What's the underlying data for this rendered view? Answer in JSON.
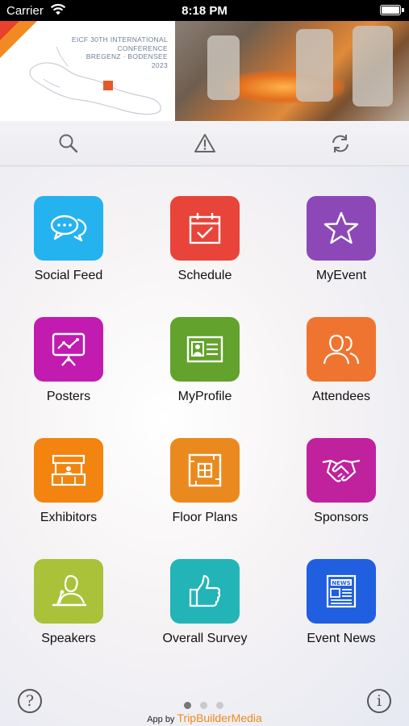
{
  "status_bar": {
    "carrier": "Carrier",
    "time": "8:18 PM"
  },
  "banner": {
    "title_lines": [
      "EICF 30TH INTERNATIONAL",
      "CONFERENCE",
      "BREGENZ · BODENSEE",
      "2023"
    ]
  },
  "toolbar": {
    "icons": [
      "search-icon",
      "alert-icon",
      "refresh-icon"
    ]
  },
  "tiles": [
    {
      "label": "Social Feed",
      "color": "#24b3ef",
      "icon": "chat-bubbles-icon"
    },
    {
      "label": "Schedule",
      "color": "#e8443a",
      "icon": "calendar-check-icon"
    },
    {
      "label": "MyEvent",
      "color": "#8d48b8",
      "icon": "star-icon"
    },
    {
      "label": "Posters",
      "color": "#c21bb0",
      "icon": "presentation-board-icon"
    },
    {
      "label": "MyProfile",
      "color": "#63a22c",
      "icon": "id-card-icon"
    },
    {
      "label": "Attendees",
      "color": "#ef7430",
      "icon": "people-icon"
    },
    {
      "label": "Exhibitors",
      "color": "#f2840f",
      "icon": "booth-icon"
    },
    {
      "label": "Floor Plans",
      "color": "#ea8a1e",
      "icon": "floor-plan-icon"
    },
    {
      "label": "Sponsors",
      "color": "#c0219d",
      "icon": "handshake-icon"
    },
    {
      "label": "Speakers",
      "color": "#a9c23a",
      "icon": "speaker-podium-icon"
    },
    {
      "label": "Overall Survey",
      "color": "#23b4b8",
      "icon": "thumbs-up-icon"
    },
    {
      "label": "Event News",
      "color": "#1f5fe0",
      "icon": "newspaper-icon"
    }
  ],
  "footer": {
    "help_icon_glyph": "?",
    "info_icon_glyph": "i",
    "page_dots": 3,
    "active_page": 1,
    "credit_prefix": "App by ",
    "credit_brand": "TripBuilderMedia"
  }
}
